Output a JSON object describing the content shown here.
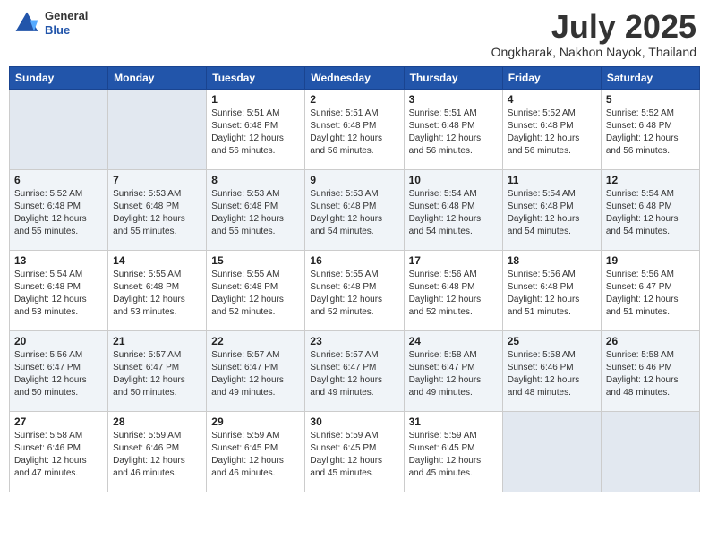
{
  "header": {
    "logo_general": "General",
    "logo_blue": "Blue",
    "title": "July 2025",
    "location": "Ongkharak, Nakhon Nayok, Thailand"
  },
  "days_of_week": [
    "Sunday",
    "Monday",
    "Tuesday",
    "Wednesday",
    "Thursday",
    "Friday",
    "Saturday"
  ],
  "weeks": [
    [
      {
        "day": "",
        "empty": true
      },
      {
        "day": "",
        "empty": true
      },
      {
        "day": "1",
        "sunrise": "Sunrise: 5:51 AM",
        "sunset": "Sunset: 6:48 PM",
        "daylight": "Daylight: 12 hours and 56 minutes."
      },
      {
        "day": "2",
        "sunrise": "Sunrise: 5:51 AM",
        "sunset": "Sunset: 6:48 PM",
        "daylight": "Daylight: 12 hours and 56 minutes."
      },
      {
        "day": "3",
        "sunrise": "Sunrise: 5:51 AM",
        "sunset": "Sunset: 6:48 PM",
        "daylight": "Daylight: 12 hours and 56 minutes."
      },
      {
        "day": "4",
        "sunrise": "Sunrise: 5:52 AM",
        "sunset": "Sunset: 6:48 PM",
        "daylight": "Daylight: 12 hours and 56 minutes."
      },
      {
        "day": "5",
        "sunrise": "Sunrise: 5:52 AM",
        "sunset": "Sunset: 6:48 PM",
        "daylight": "Daylight: 12 hours and 56 minutes."
      }
    ],
    [
      {
        "day": "6",
        "sunrise": "Sunrise: 5:52 AM",
        "sunset": "Sunset: 6:48 PM",
        "daylight": "Daylight: 12 hours and 55 minutes."
      },
      {
        "day": "7",
        "sunrise": "Sunrise: 5:53 AM",
        "sunset": "Sunset: 6:48 PM",
        "daylight": "Daylight: 12 hours and 55 minutes."
      },
      {
        "day": "8",
        "sunrise": "Sunrise: 5:53 AM",
        "sunset": "Sunset: 6:48 PM",
        "daylight": "Daylight: 12 hours and 55 minutes."
      },
      {
        "day": "9",
        "sunrise": "Sunrise: 5:53 AM",
        "sunset": "Sunset: 6:48 PM",
        "daylight": "Daylight: 12 hours and 54 minutes."
      },
      {
        "day": "10",
        "sunrise": "Sunrise: 5:54 AM",
        "sunset": "Sunset: 6:48 PM",
        "daylight": "Daylight: 12 hours and 54 minutes."
      },
      {
        "day": "11",
        "sunrise": "Sunrise: 5:54 AM",
        "sunset": "Sunset: 6:48 PM",
        "daylight": "Daylight: 12 hours and 54 minutes."
      },
      {
        "day": "12",
        "sunrise": "Sunrise: 5:54 AM",
        "sunset": "Sunset: 6:48 PM",
        "daylight": "Daylight: 12 hours and 54 minutes."
      }
    ],
    [
      {
        "day": "13",
        "sunrise": "Sunrise: 5:54 AM",
        "sunset": "Sunset: 6:48 PM",
        "daylight": "Daylight: 12 hours and 53 minutes."
      },
      {
        "day": "14",
        "sunrise": "Sunrise: 5:55 AM",
        "sunset": "Sunset: 6:48 PM",
        "daylight": "Daylight: 12 hours and 53 minutes."
      },
      {
        "day": "15",
        "sunrise": "Sunrise: 5:55 AM",
        "sunset": "Sunset: 6:48 PM",
        "daylight": "Daylight: 12 hours and 52 minutes."
      },
      {
        "day": "16",
        "sunrise": "Sunrise: 5:55 AM",
        "sunset": "Sunset: 6:48 PM",
        "daylight": "Daylight: 12 hours and 52 minutes."
      },
      {
        "day": "17",
        "sunrise": "Sunrise: 5:56 AM",
        "sunset": "Sunset: 6:48 PM",
        "daylight": "Daylight: 12 hours and 52 minutes."
      },
      {
        "day": "18",
        "sunrise": "Sunrise: 5:56 AM",
        "sunset": "Sunset: 6:48 PM",
        "daylight": "Daylight: 12 hours and 51 minutes."
      },
      {
        "day": "19",
        "sunrise": "Sunrise: 5:56 AM",
        "sunset": "Sunset: 6:47 PM",
        "daylight": "Daylight: 12 hours and 51 minutes."
      }
    ],
    [
      {
        "day": "20",
        "sunrise": "Sunrise: 5:56 AM",
        "sunset": "Sunset: 6:47 PM",
        "daylight": "Daylight: 12 hours and 50 minutes."
      },
      {
        "day": "21",
        "sunrise": "Sunrise: 5:57 AM",
        "sunset": "Sunset: 6:47 PM",
        "daylight": "Daylight: 12 hours and 50 minutes."
      },
      {
        "day": "22",
        "sunrise": "Sunrise: 5:57 AM",
        "sunset": "Sunset: 6:47 PM",
        "daylight": "Daylight: 12 hours and 49 minutes."
      },
      {
        "day": "23",
        "sunrise": "Sunrise: 5:57 AM",
        "sunset": "Sunset: 6:47 PM",
        "daylight": "Daylight: 12 hours and 49 minutes."
      },
      {
        "day": "24",
        "sunrise": "Sunrise: 5:58 AM",
        "sunset": "Sunset: 6:47 PM",
        "daylight": "Daylight: 12 hours and 49 minutes."
      },
      {
        "day": "25",
        "sunrise": "Sunrise: 5:58 AM",
        "sunset": "Sunset: 6:46 PM",
        "daylight": "Daylight: 12 hours and 48 minutes."
      },
      {
        "day": "26",
        "sunrise": "Sunrise: 5:58 AM",
        "sunset": "Sunset: 6:46 PM",
        "daylight": "Daylight: 12 hours and 48 minutes."
      }
    ],
    [
      {
        "day": "27",
        "sunrise": "Sunrise: 5:58 AM",
        "sunset": "Sunset: 6:46 PM",
        "daylight": "Daylight: 12 hours and 47 minutes."
      },
      {
        "day": "28",
        "sunrise": "Sunrise: 5:59 AM",
        "sunset": "Sunset: 6:46 PM",
        "daylight": "Daylight: 12 hours and 46 minutes."
      },
      {
        "day": "29",
        "sunrise": "Sunrise: 5:59 AM",
        "sunset": "Sunset: 6:45 PM",
        "daylight": "Daylight: 12 hours and 46 minutes."
      },
      {
        "day": "30",
        "sunrise": "Sunrise: 5:59 AM",
        "sunset": "Sunset: 6:45 PM",
        "daylight": "Daylight: 12 hours and 45 minutes."
      },
      {
        "day": "31",
        "sunrise": "Sunrise: 5:59 AM",
        "sunset": "Sunset: 6:45 PM",
        "daylight": "Daylight: 12 hours and 45 minutes."
      },
      {
        "day": "",
        "empty": true
      },
      {
        "day": "",
        "empty": true
      }
    ]
  ]
}
